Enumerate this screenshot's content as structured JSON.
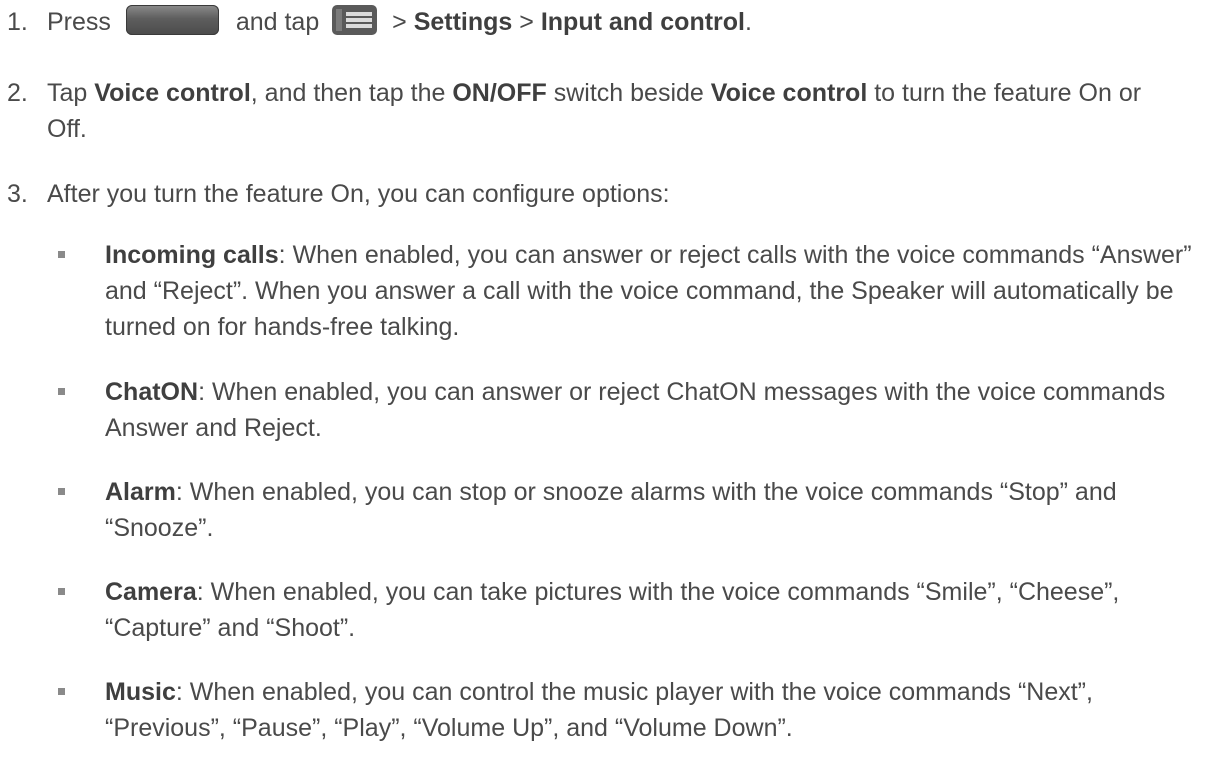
{
  "steps": [
    {
      "number": "1.",
      "press": "Press",
      "and_tap": "and tap",
      "sep1": ">",
      "settings": "Settings",
      "sep2": ">",
      "input_control": "Input and control",
      "end": "."
    },
    {
      "number": "2.",
      "tap": "Tap",
      "voice_control": "Voice control",
      "mid1": ", and then tap the",
      "onoff": "ON/OFF",
      "mid2": "switch beside",
      "voice_control2": "Voice control",
      "mid3": "to turn the feature On or Off."
    },
    {
      "number": "3.",
      "text": "After you turn the feature On, you can configure options:"
    }
  ],
  "options": [
    {
      "title": "Incoming calls",
      "desc": ": When enabled, you can answer or reject calls with the voice commands “Answer” and “Reject”. When you answer a call with the voice command, the Speaker will automatically be turned on for hands-free talking."
    },
    {
      "title": "ChatON",
      "desc": ": When enabled, you can answer or reject ChatON messages with the voice commands Answer and Reject."
    },
    {
      "title": "Alarm",
      "desc": ": When enabled, you can stop or snooze alarms with the voice commands “Stop” and “Snooze”."
    },
    {
      "title": "Camera",
      "desc": ": When enabled, you can take pictures with the voice commands “Smile”, “Cheese”, “Capture” and “Shoot”."
    },
    {
      "title": "Music",
      "desc": ": When enabled, you can control the music player with the voice commands “Next”, “Previous”, “Pause”, “Play”, “Volume Up”, and “Volume Down”."
    }
  ],
  "icons": {
    "home_button": "home-button-icon",
    "menu_button": "menu-icon"
  },
  "colors": {
    "text": "#4a4a4a",
    "bullet": "#8a8a8a"
  }
}
